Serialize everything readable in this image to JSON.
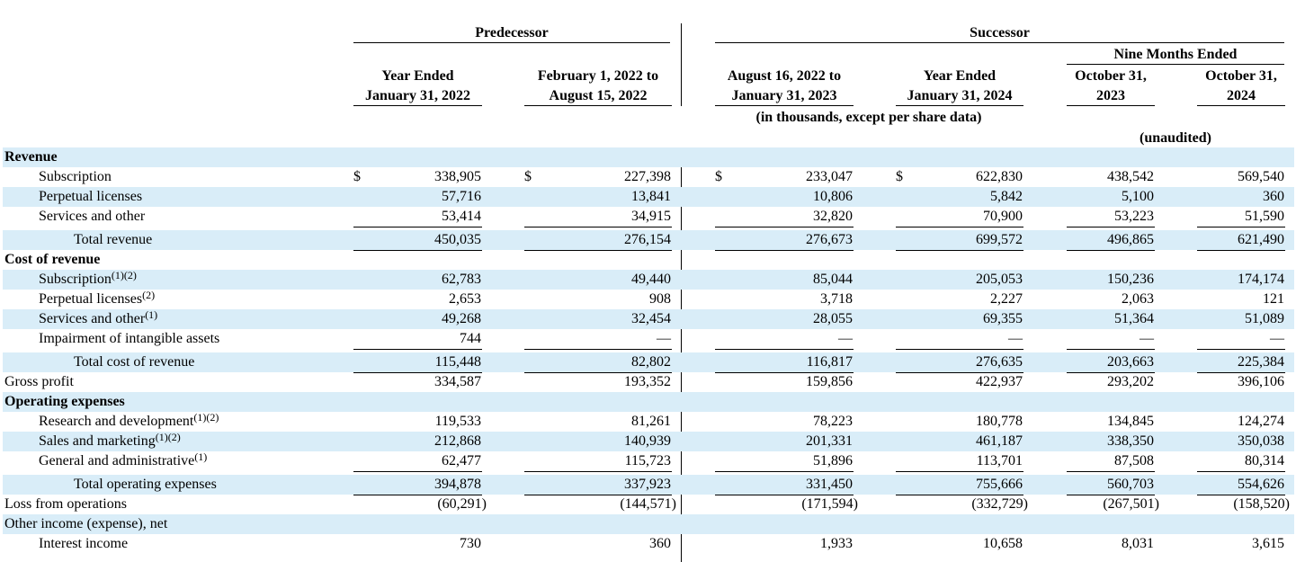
{
  "header": {
    "predecessor": "Predecessor",
    "successor": "Successor",
    "nine_months": "Nine Months Ended",
    "units": "(in thousands, except per share data)",
    "unaudited": "(unaudited)",
    "columns": [
      {
        "line1": "Year Ended",
        "line2": "January 31, 2022"
      },
      {
        "line1": "February 1, 2022 to",
        "line2": "August 15, 2022"
      },
      {
        "line1": "August 16, 2022 to",
        "line2": "January 31, 2023"
      },
      {
        "line1": "Year Ended",
        "line2": "January 31, 2024"
      },
      {
        "line1": "October 31,",
        "line2": "2023"
      },
      {
        "line1": "October 31,",
        "line2": "2024"
      }
    ]
  },
  "rows": [
    {
      "label": "Revenue",
      "bold": true,
      "band": true,
      "indent": 0,
      "values": []
    },
    {
      "label": "Subscription",
      "indent": 1,
      "band": false,
      "dollar": true,
      "values": [
        "338,905",
        "227,398",
        "233,047",
        "622,830",
        "438,542",
        "569,540"
      ]
    },
    {
      "label": "Perpetual licenses",
      "indent": 1,
      "band": true,
      "values": [
        "57,716",
        "13,841",
        "10,806",
        "5,842",
        "5,100",
        "360"
      ]
    },
    {
      "label": "Services and other",
      "indent": 1,
      "band": false,
      "underline": true,
      "values": [
        "53,414",
        "34,915",
        "32,820",
        "70,900",
        "53,223",
        "51,590"
      ]
    },
    {
      "label": "Total revenue",
      "indent": 2,
      "band": true,
      "total": true,
      "values": [
        "450,035",
        "276,154",
        "276,673",
        "699,572",
        "496,865",
        "621,490"
      ]
    },
    {
      "label": "Cost of revenue",
      "bold": true,
      "band": false,
      "indent": 0,
      "values": []
    },
    {
      "label": "Subscription",
      "sup": "(1)(2)",
      "indent": 1,
      "band": true,
      "values": [
        "62,783",
        "49,440",
        "85,044",
        "205,053",
        "150,236",
        "174,174"
      ]
    },
    {
      "label": "Perpetual licenses",
      "sup": "(2)",
      "indent": 1,
      "band": false,
      "values": [
        "2,653",
        "908",
        "3,718",
        "2,227",
        "2,063",
        "121"
      ]
    },
    {
      "label": "Services and other",
      "sup": "(1)",
      "indent": 1,
      "band": true,
      "values": [
        "49,268",
        "32,454",
        "28,055",
        "69,355",
        "51,364",
        "51,089"
      ]
    },
    {
      "label": "Impairment of intangible assets",
      "indent": 1,
      "band": false,
      "underline": true,
      "values": [
        "744",
        "—",
        "—",
        "—",
        "—",
        "—"
      ]
    },
    {
      "label": "Total cost of revenue",
      "indent": 2,
      "band": true,
      "total": true,
      "values": [
        "115,448",
        "82,802",
        "116,817",
        "276,635",
        "203,663",
        "225,384"
      ]
    },
    {
      "label": "Gross profit",
      "indent": 0,
      "band": false,
      "values": [
        "334,587",
        "193,352",
        "159,856",
        "422,937",
        "293,202",
        "396,106"
      ]
    },
    {
      "label": "Operating expenses",
      "bold": true,
      "band": true,
      "indent": 0,
      "values": []
    },
    {
      "label": "Research and development",
      "sup": "(1)(2)",
      "indent": 1,
      "band": false,
      "values": [
        "119,533",
        "81,261",
        "78,223",
        "180,778",
        "134,845",
        "124,274"
      ]
    },
    {
      "label": "Sales and marketing",
      "sup": "(1)(2)",
      "indent": 1,
      "band": true,
      "values": [
        "212,868",
        "140,939",
        "201,331",
        "461,187",
        "338,350",
        "350,038"
      ]
    },
    {
      "label": "General and administrative",
      "sup": "(1)",
      "indent": 1,
      "band": false,
      "underline": true,
      "values": [
        "62,477",
        "115,723",
        "51,896",
        "113,701",
        "87,508",
        "80,314"
      ]
    },
    {
      "label": "Total operating expenses",
      "indent": 2,
      "band": true,
      "total": true,
      "values": [
        "394,878",
        "337,923",
        "331,450",
        "755,666",
        "560,703",
        "554,626"
      ]
    },
    {
      "label": "Loss from operations",
      "indent": 0,
      "band": false,
      "neg": true,
      "values": [
        "(60,291)",
        "(144,571)",
        "(171,594)",
        "(332,729)",
        "(267,501)",
        "(158,520)"
      ]
    },
    {
      "label": "Other income (expense), net",
      "indent": 0,
      "band": true,
      "values": []
    },
    {
      "label": "Interest income",
      "indent": 1,
      "band": false,
      "values": [
        "730",
        "360",
        "1,933",
        "10,658",
        "8,031",
        "3,615"
      ]
    }
  ]
}
